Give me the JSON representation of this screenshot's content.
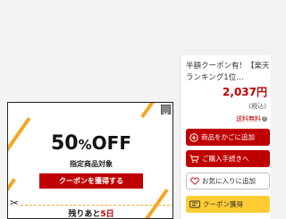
{
  "product": {
    "title": "半額クーポン有！【楽天ランキング1位…",
    "price": "2,037円",
    "tax_note": "(税込)",
    "shipping": "送料無料"
  },
  "actions": {
    "add_to_cart": "商品をかごに追加",
    "checkout": "ご購入手続きへ",
    "favorite": "お気に入りに追加",
    "coupon": "クーポン獲得"
  },
  "coupon_popup": {
    "discount_number": "50",
    "discount_percent": "%",
    "discount_off": "OFF",
    "target": "指定商品対象",
    "get_button": "クーポンを獲得する",
    "remaining_prefix": "残りあと",
    "remaining_days": "5日"
  },
  "colors": {
    "accent_red": "#bf0000",
    "coupon_yellow": "#ffcc33",
    "stripe_orange": "#f5a623"
  },
  "icons": {
    "cart": "cart-icon",
    "plus": "plus-circle-icon",
    "heart": "heart-icon",
    "coupon": "coupon-icon",
    "close": "close-icon",
    "scissors": "scissors-icon",
    "help": "question-icon"
  }
}
